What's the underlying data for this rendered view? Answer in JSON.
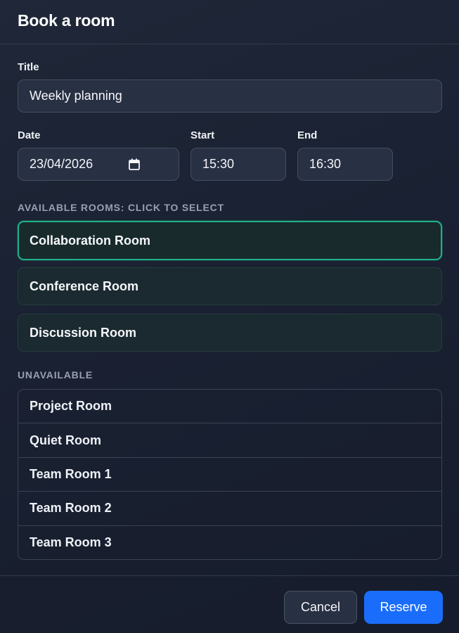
{
  "dialog": {
    "title": "Book a room"
  },
  "form": {
    "title_label": "Title",
    "title_value": "Weekly planning",
    "date_label": "Date",
    "date_value": "23/04/2026",
    "date_icon": "calendar-icon",
    "start_label": "Start",
    "start_value": "15:30",
    "end_label": "End",
    "end_value": "16:30"
  },
  "available": {
    "heading": "AVAILABLE ROOMS: CLICK TO SELECT",
    "selected_index": 0,
    "rooms": [
      "Collaboration Room",
      "Conference Room",
      "Discussion Room"
    ]
  },
  "unavailable": {
    "heading": "UNAVAILABLE",
    "rooms": [
      "Project Room",
      "Quiet Room",
      "Team Room 1",
      "Team Room 2",
      "Team Room 3"
    ]
  },
  "footer": {
    "cancel_label": "Cancel",
    "reserve_label": "Reserve"
  },
  "colors": {
    "accent": "#1a6dfb",
    "selected_border": "#1fb086"
  }
}
